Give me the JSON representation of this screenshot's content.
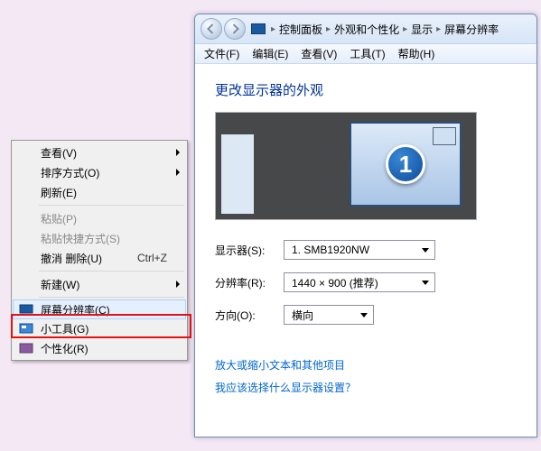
{
  "context_menu": {
    "items": [
      {
        "label": "查看(V)",
        "submenu": true
      },
      {
        "label": "排序方式(O)",
        "submenu": true
      },
      {
        "label": "刷新(E)"
      },
      {
        "sep": true
      },
      {
        "label": "粘贴(P)",
        "disabled": true
      },
      {
        "label": "粘贴快捷方式(S)",
        "disabled": true
      },
      {
        "label": "撤消 删除(U)",
        "shortcut": "Ctrl+Z"
      },
      {
        "sep": true
      },
      {
        "label": "新建(W)",
        "submenu": true
      },
      {
        "sep": true
      },
      {
        "label": "屏幕分辨率(C)",
        "icon": "monitor-icon",
        "highlighted": true
      },
      {
        "label": "小工具(G)",
        "icon": "gadget-icon"
      },
      {
        "label": "个性化(R)",
        "icon": "personalize-icon"
      }
    ]
  },
  "window": {
    "breadcrumbs": [
      "控制面板",
      "外观和个性化",
      "显示",
      "屏幕分辨率"
    ],
    "menubar": [
      "文件(F)",
      "编辑(E)",
      "查看(V)",
      "工具(T)",
      "帮助(H)"
    ],
    "title": "更改显示器的外观",
    "monitor_number": "1",
    "fields": {
      "display": {
        "label": "显示器(S):",
        "value": "1. SMB1920NW"
      },
      "resolution": {
        "label": "分辨率(R):",
        "value": "1440 × 900 (推荐)"
      },
      "orientation": {
        "label": "方向(O):",
        "value": "横向"
      }
    },
    "links": {
      "text_size": "放大或缩小文本和其他项目",
      "which_display": "我应该选择什么显示器设置？"
    }
  }
}
